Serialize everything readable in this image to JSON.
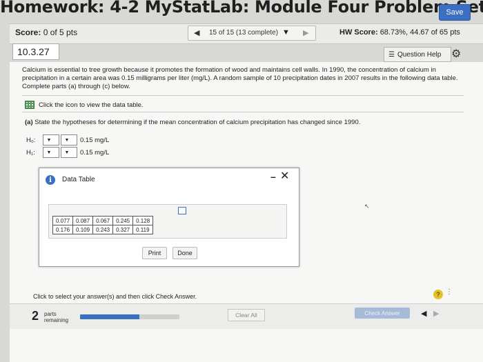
{
  "header": {
    "title": "Homework: 4-2 MyStatLab: Module Four Problem Set",
    "save_label": "Save"
  },
  "scorebar": {
    "score_label": "Score:",
    "score_value": "0 of 5 pts",
    "pager_text": "15 of 15 (13 complete)",
    "hw_score_label": "HW Score:",
    "hw_score_value": "68.73%, 44.67 of 65 pts"
  },
  "question": {
    "number": "10.3.27",
    "help_label": "Question Help",
    "text": "Calcium is essential to tree growth because it promotes the formation of wood and maintains cell walls. In 1990, the concentration of calcium in precipitation in a certain area was 0.15 milligrams per liter (mg/L). A random sample of 10 precipitation dates in 2007 results in the following data table. Complete parts (a) through (c) below.",
    "table_link": "Click the icon to view the data table.",
    "part_a_label": "(a)",
    "part_a_text": "State the hypotheses for determining if the mean concentration of calcium precipitation has changed since 1990.",
    "h0_label": "H₀:",
    "h1_label": "H₁:",
    "h0_value": "0.15 mg/L",
    "h1_value": "0.15 mg/L"
  },
  "modal": {
    "title": "Data Table",
    "rows": [
      [
        "0.077",
        "0.087",
        "0.067",
        "0.245",
        "0.128"
      ],
      [
        "0.176",
        "0.109",
        "0.243",
        "0.327",
        "0.119"
      ]
    ],
    "print_label": "Print",
    "done_label": "Done"
  },
  "footer": {
    "instruction": "Click to select your answer(s) and then click Check Answer.",
    "parts_count": "2",
    "parts_label_1": "parts",
    "parts_label_2": "remaining",
    "progress_fraction": 0.6,
    "clear_label": "Clear All",
    "check_label": "Check Answer"
  },
  "colors": {
    "accent": "#3a6fc1",
    "help_yellow": "#e3c12b"
  },
  "icons": [
    "info-icon",
    "gear-icon",
    "grid-table-icon",
    "close-icon",
    "minimize-icon",
    "copy-icon",
    "question-help-icon",
    "chevron-left-icon",
    "chevron-right-icon",
    "dropdown-icon"
  ]
}
